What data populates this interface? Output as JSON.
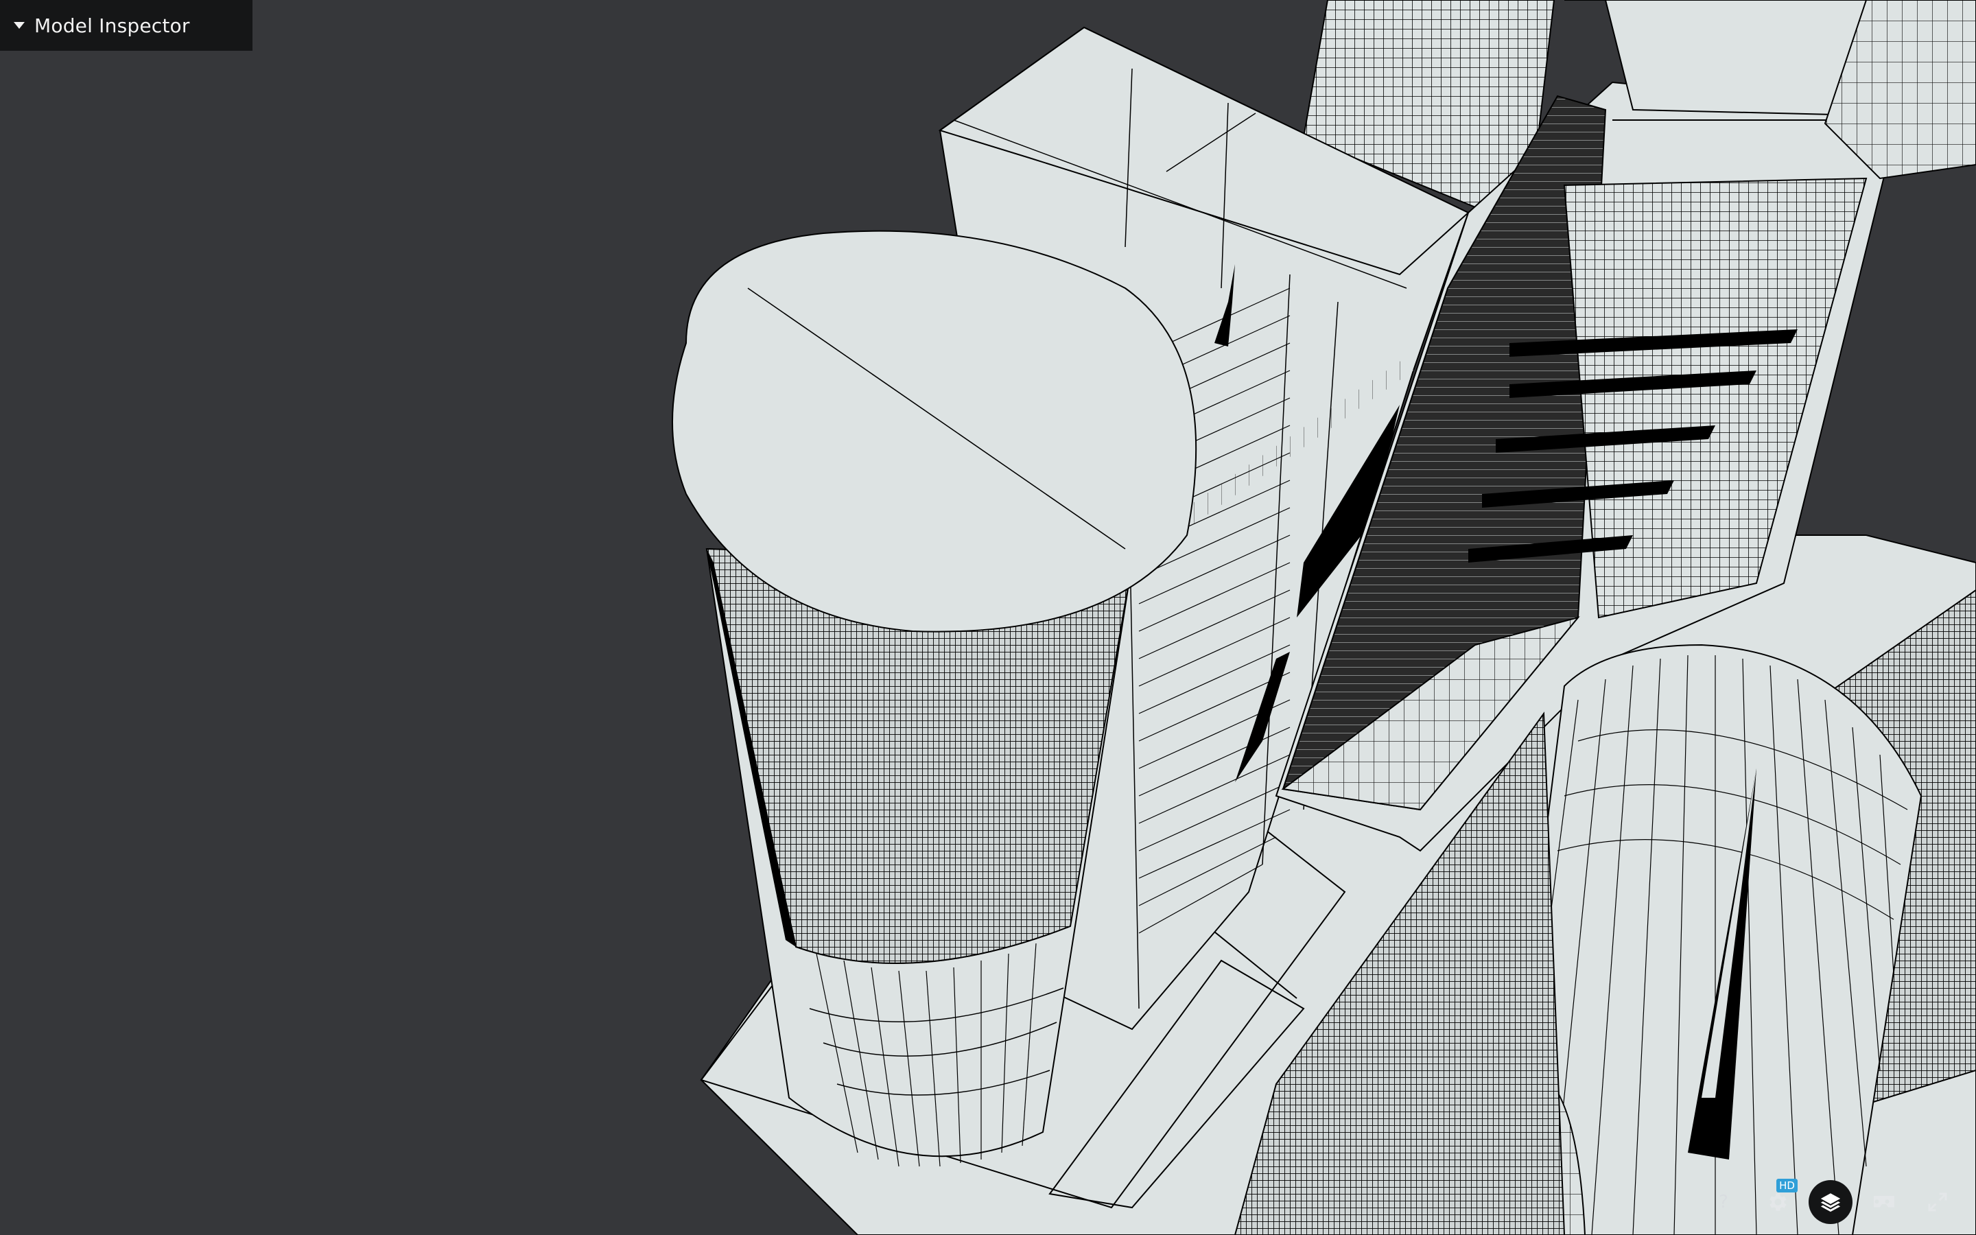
{
  "inspector": {
    "label": "Model Inspector"
  },
  "toolbar": {
    "help_glyph": "?",
    "settings_icon": "gear-icon",
    "hd_badge": "HD",
    "layers_icon": "layers-icon",
    "vr_icon": "vr-headset-icon",
    "fullscreen_icon": "fullscreen-icon"
  },
  "colors": {
    "background": "#36373a",
    "panel": "#151617",
    "model_surface": "#dde3e3",
    "model_lines": "#000000",
    "accent_badge": "#2f9fd8"
  }
}
